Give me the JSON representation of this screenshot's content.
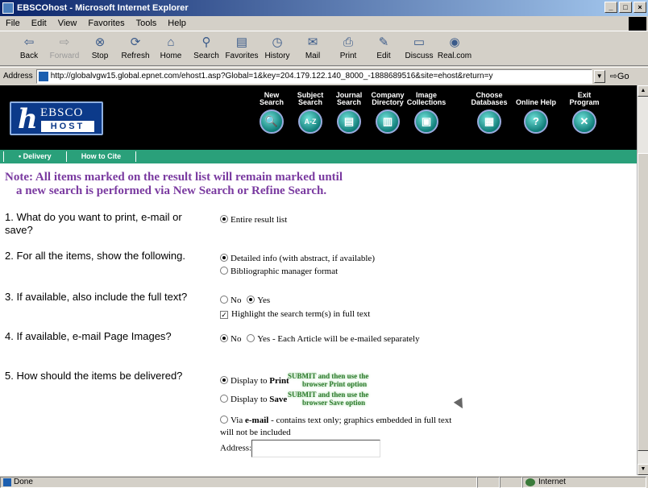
{
  "window": {
    "title": "EBSCOhost - Microsoft Internet Explorer",
    "buttons": [
      "_",
      "□",
      "×"
    ]
  },
  "menu": [
    "File",
    "Edit",
    "View",
    "Favorites",
    "Tools",
    "Help"
  ],
  "toolbar": {
    "back": "Back",
    "forward": "Forward",
    "stop": "Stop",
    "refresh": "Refresh",
    "home": "Home",
    "search": "Search",
    "favorites": "Favorites",
    "history": "History",
    "mail": "Mail",
    "print": "Print",
    "edit": "Edit",
    "discuss": "Discuss",
    "realcom": "Real.com"
  },
  "address": {
    "label": "Address",
    "url": "http://globalvgw15.global.epnet.com/ehost1.asp?Global=1&key=204.179.122.140_8000_-1888689516&site=ehost&return=y",
    "go": "Go"
  },
  "ebsco": {
    "logo_top": "EBSCO",
    "logo_bottom": "HOST",
    "nav": [
      {
        "label": "New Search",
        "symbol": "🔍"
      },
      {
        "label": "Subject Search",
        "symbol": "A-Z"
      },
      {
        "label": "Journal Search",
        "symbol": "▤"
      },
      {
        "label": "Company Directory",
        "symbol": "▥"
      },
      {
        "label": "Image Collections",
        "symbol": "▣"
      },
      {
        "label": "Choose Databases",
        "symbol": "▦"
      },
      {
        "label": "Online Help",
        "symbol": "?"
      },
      {
        "label": "Exit Program",
        "symbol": "✕"
      }
    ],
    "tabs": [
      "• Delivery",
      "How to Cite"
    ]
  },
  "note": {
    "line1": "Note: All items marked on the result list will remain marked until",
    "line2": "a new search is performed via New Search or Refine Search."
  },
  "questions": {
    "q1": {
      "text": "1. What do you want to print, e-mail or save?",
      "opt1": "Entire result list"
    },
    "q2": {
      "text": "2. For all the items, show the following.",
      "opt1": "Detailed info (with abstract, if available)",
      "opt2": "Bibliographic manager format"
    },
    "q3": {
      "text": "3. If available, also include the full text?",
      "no": "No",
      "yes": "Yes",
      "highlight": "Highlight the search term(s) in full text"
    },
    "q4": {
      "text": "4. If available, e-mail Page Images?",
      "no": "No",
      "yes": "Yes - Each Article will be e-mailed separately"
    },
    "q5": {
      "text": "5. How should the items be delivered?",
      "print_prefix": "Display to",
      "print_bold": "Print",
      "print_note_1": "SUBMIT and then use the",
      "print_note_2": "browser Print option",
      "save_prefix": "Display to",
      "save_bold": "Save",
      "save_note_1": "SUBMIT and then use the",
      "save_note_2": "browser Save option",
      "email_prefix": "Via",
      "email_bold": "e-mail",
      "email_rest": "- contains text only; graphics embedded in full text",
      "email_rest2": "will not be included",
      "address_label": "Address:"
    }
  },
  "status": {
    "text": "Done",
    "zone": "Internet"
  }
}
